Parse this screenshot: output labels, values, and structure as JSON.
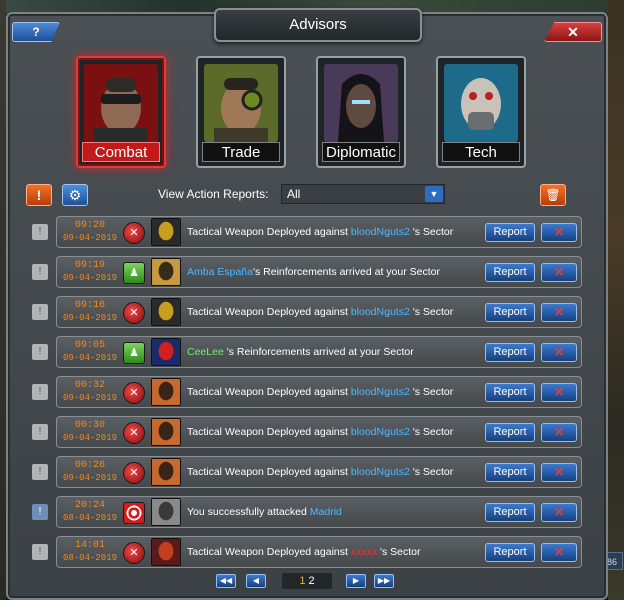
{
  "window": {
    "title": "Advisors",
    "help_label": "?",
    "close_label": "✕"
  },
  "advisors": [
    {
      "label": "Combat",
      "active": true
    },
    {
      "label": "Trade",
      "active": false
    },
    {
      "label": "Diplomatic",
      "active": false
    },
    {
      "label": "Tech",
      "active": false
    }
  ],
  "toolbar": {
    "alert_label": "!",
    "settings_icon": "gear-icon",
    "filter_label": "View Action Reports:",
    "filter_value": "All",
    "trash_icon": "trash-icon"
  },
  "reports": [
    {
      "time": "09:20",
      "date": "09-04-2019",
      "type": "weapon",
      "pre": "Tactical Weapon Deployed against ",
      "name": "bloodNguts2",
      "name_color": "blue",
      "post": " 's Sector",
      "unread": false
    },
    {
      "time": "09:19",
      "date": "09-04-2019",
      "type": "reinf",
      "pre": "",
      "name": "Amba España",
      "name_color": "blue",
      "post": "'s Reinforcements arrived at your Sector",
      "unread": false
    },
    {
      "time": "09:16",
      "date": "09-04-2019",
      "type": "weapon",
      "pre": "Tactical Weapon Deployed against ",
      "name": "bloodNguts2",
      "name_color": "blue",
      "post": " 's Sector",
      "unread": false
    },
    {
      "time": "09:05",
      "date": "09-04-2019",
      "type": "reinf",
      "pre": "",
      "name": "CeeLee",
      "name_color": "green",
      "post": " 's Reinforcements arrived at your Sector",
      "unread": false
    },
    {
      "time": "00:32",
      "date": "09-04-2019",
      "type": "weapon",
      "pre": "Tactical Weapon Deployed against ",
      "name": "bloodNguts2",
      "name_color": "blue",
      "post": " 's Sector",
      "unread": false
    },
    {
      "time": "00:30",
      "date": "09-04-2019",
      "type": "weapon",
      "pre": "Tactical Weapon Deployed against ",
      "name": "bloodNguts2",
      "name_color": "blue",
      "post": " 's Sector",
      "unread": false
    },
    {
      "time": "00:26",
      "date": "09-04-2019",
      "type": "weapon",
      "pre": "Tactical Weapon Deployed against ",
      "name": "bloodNguts2",
      "name_color": "blue",
      "post": " 's Sector",
      "unread": false
    },
    {
      "time": "20:24",
      "date": "08-04-2019",
      "type": "attack",
      "pre": "You successfully attacked ",
      "name": "Madrid",
      "name_color": "blue",
      "post": "",
      "unread": true
    },
    {
      "time": "14:01",
      "date": "08-04-2019",
      "type": "weapon",
      "pre": "Tactical Weapon Deployed against ",
      "name": "xxxxx",
      "name_color": "red",
      "post": " 's Sector",
      "unread": false
    }
  ],
  "report_button_label": "Report",
  "delete_button_label": "✕",
  "row_check_label": "!",
  "pagination": {
    "current": "1",
    "other": "2"
  },
  "side_badge": "86"
}
